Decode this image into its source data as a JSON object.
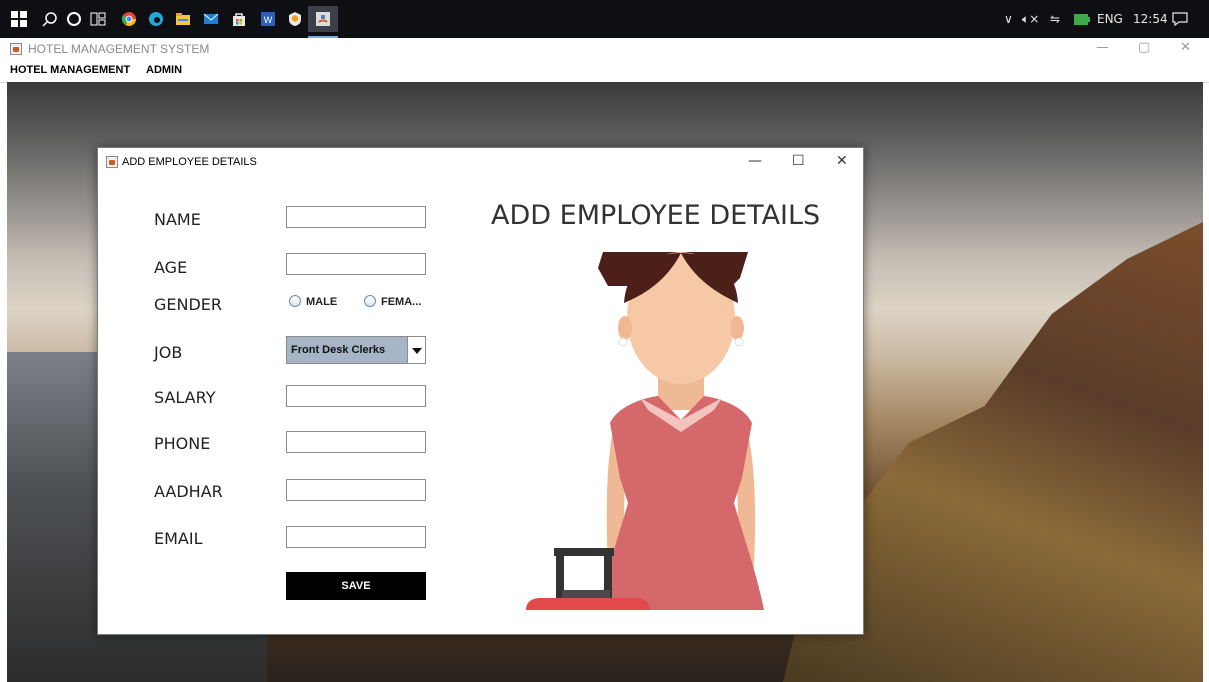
{
  "taskbar": {
    "tray": {
      "language": "ENG",
      "time": "12:54"
    }
  },
  "app": {
    "title": "HOTEL MANAGEMENT SYSTEM",
    "menu": [
      "HOTEL MANAGEMENT",
      "ADMIN"
    ]
  },
  "dialog": {
    "title": "ADD EMPLOYEE DETAILS",
    "heading": "ADD EMPLOYEE DETAILS",
    "labels": {
      "name": "NAME",
      "age": "AGE",
      "gender": "GENDER",
      "job": "JOB",
      "salary": "SALARY",
      "phone": "PHONE",
      "aadhar": "AADHAR",
      "email": "EMAIL"
    },
    "gender_options": [
      "MALE",
      "FEMA..."
    ],
    "job_selected": "Front Desk Clerks",
    "save_label": "SAVE"
  },
  "colors": {
    "save_bg": "#000000",
    "combo_bg": "#a7b4c5",
    "dress": "#d4686b",
    "hair": "#4d1f19",
    "skin": "#f7c8a6"
  }
}
